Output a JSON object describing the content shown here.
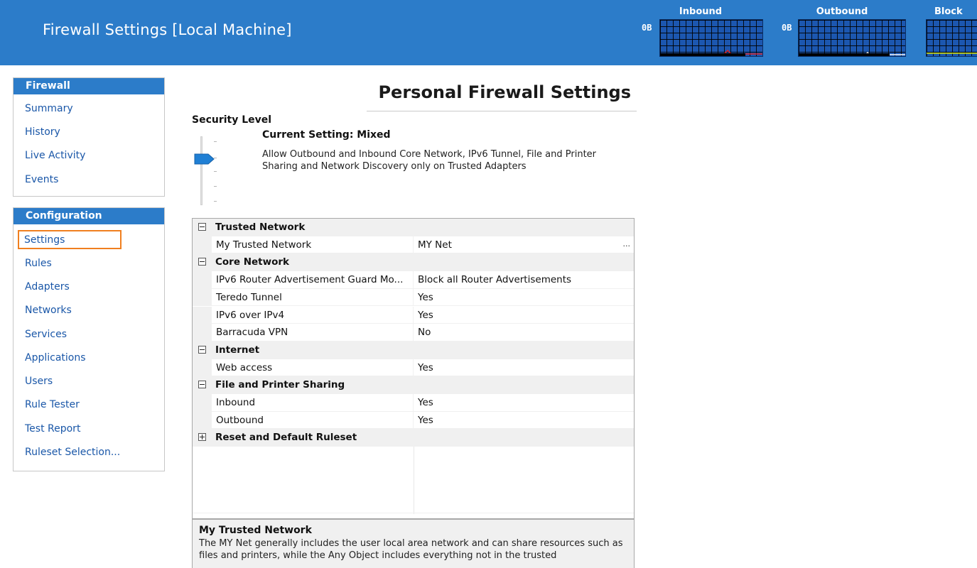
{
  "header": {
    "title": "Firewall Settings [Local Machine]",
    "monitors": [
      {
        "label": "Inbound",
        "value": "0B",
        "line_color": "#e02020"
      },
      {
        "label": "Outbound",
        "value": "0B",
        "line_color": "#ffffff"
      },
      {
        "label": "Block",
        "line_color": "#d8e000"
      }
    ]
  },
  "sidebar": {
    "firewall": {
      "heading": "Firewall",
      "items": [
        "Summary",
        "History",
        "Live Activity",
        "Events"
      ]
    },
    "configuration": {
      "heading": "Configuration",
      "items": [
        "Settings",
        "Rules",
        "Adapters",
        "Networks",
        "Services",
        "Applications",
        "Users",
        "Rule Tester",
        "Test Report",
        "Ruleset Selection..."
      ],
      "selected": "Settings"
    }
  },
  "main": {
    "title": "Personal Firewall Settings",
    "security": {
      "label": "Security Level",
      "current": "Current Setting: Mixed",
      "description": "Allow Outbound and Inbound Core Network, IPv6 Tunnel, File and Printer Sharing and Network Discovery only on Trusted Adapters"
    },
    "grid": {
      "trusted": {
        "title": "Trusted Network",
        "my_trusted_name": "My Trusted Network",
        "my_trusted_value": "MY Net",
        "browse": "..."
      },
      "core": {
        "title": "Core Network",
        "ra_name": "IPv6 Router Advertisement Guard Mo...",
        "ra_value": "Block all Router Advertisements",
        "teredo_name": "Teredo Tunnel",
        "teredo_value": "Yes",
        "ipv6_name": "IPv6 over IPv4",
        "ipv6_value": "Yes",
        "vpn_name": "Barracuda VPN",
        "vpn_value": "No"
      },
      "internet": {
        "title": "Internet",
        "web_name": "Web access",
        "web_value": "Yes"
      },
      "sharing": {
        "title": "File and Printer Sharing",
        "inbound_name": "Inbound",
        "inbound_value": "Yes",
        "outbound_name": "Outbound",
        "outbound_value": "Yes"
      },
      "reset": {
        "title": "Reset and Default Ruleset"
      }
    },
    "help": {
      "title": "My Trusted Network",
      "text": "The MY Net generally includes the user local area network and can share resources such as files and printers, while the Any Object includes everything not in the trusted"
    }
  },
  "colors": {
    "header_blue": "#2c7cc9",
    "link_blue": "#1a57a8",
    "selection_orange": "#f07f1f"
  }
}
